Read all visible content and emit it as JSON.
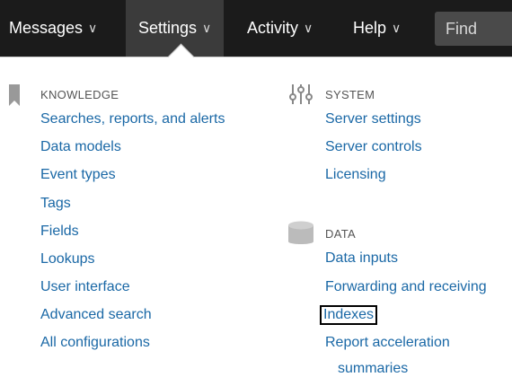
{
  "nav": {
    "messages": "Messages",
    "settings": "Settings",
    "activity": "Activity",
    "help": "Help",
    "chevron": "∨",
    "find_placeholder": "Find"
  },
  "knowledge": {
    "heading": "KNOWLEDGE",
    "icon": "bookmark-icon",
    "items": [
      "Searches, reports, and alerts",
      "Data models",
      "Event types",
      "Tags",
      "Fields",
      "Lookups",
      "User interface",
      "Advanced search",
      "All configurations"
    ]
  },
  "system": {
    "heading": "SYSTEM",
    "icon": "sliders-icon",
    "items": [
      "Server settings",
      "Server controls",
      "Licensing"
    ]
  },
  "data": {
    "heading": "DATA",
    "icon": "database-icon",
    "items": [
      "Data inputs",
      "Forwarding and receiving",
      "Indexes",
      "Report acceleration",
      "summaries"
    ]
  },
  "colors": {
    "topbar": "#1b1b1b",
    "active_tab": "#3b3b3b",
    "link": "#1a68a6",
    "heading": "#555555"
  }
}
